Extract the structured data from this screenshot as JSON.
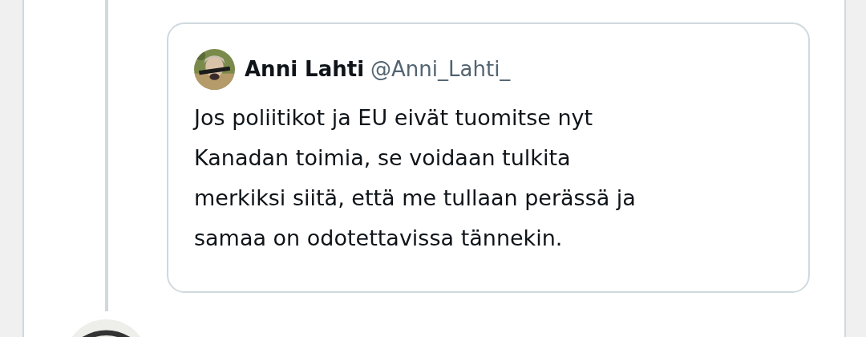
{
  "quoted_tweet": {
    "author": {
      "name": "Anni Lahti",
      "handle": "@Anni_Lahti_"
    },
    "text": "Jos poliitikot ja EU eivät tuomitse nyt\nKanadan toimia, se voidaan tulkita\nmerkiksi siitä, että me tullaan perässä ja\nsamaa on odotettavissa tännekin."
  }
}
